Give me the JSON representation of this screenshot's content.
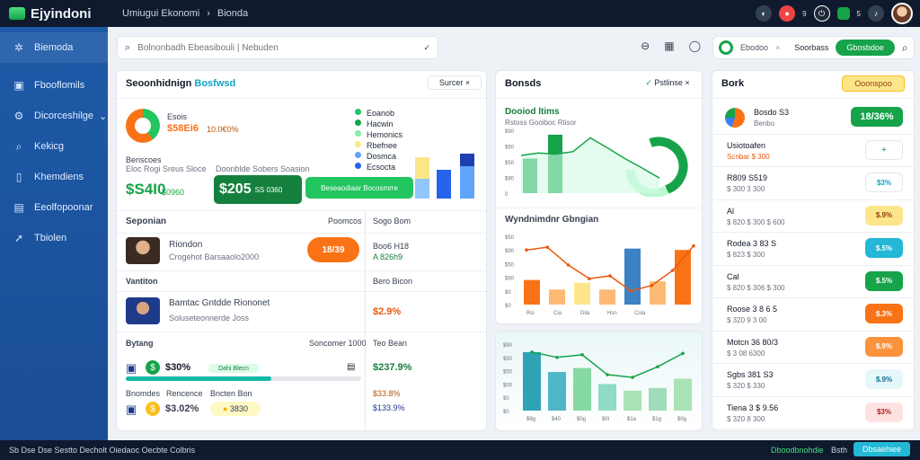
{
  "app": {
    "name": "Ejyindoni",
    "breadcrumb": [
      "Umiugui Ekonomi",
      "Bionda"
    ]
  },
  "topbar": {
    "notification_count": "9",
    "status_badge": "5"
  },
  "sidebar": {
    "items": [
      {
        "icon": "gear-icon",
        "label": "Biemoda"
      },
      {
        "icon": "grid-icon",
        "label": "Fbooflomils"
      },
      {
        "icon": "settings-icon",
        "label": "Dicorceshilge"
      },
      {
        "icon": "search-icon",
        "label": "Kekicg"
      },
      {
        "icon": "document-icon",
        "label": "Khemdiens"
      },
      {
        "icon": "image-icon",
        "label": "Eeolfopoonar"
      },
      {
        "icon": "send-icon",
        "label": "Tbiolen"
      }
    ]
  },
  "search": {
    "placeholder": "Bolnonbadh Ebeasibouli | Nebuden"
  },
  "tools": {
    "label": "Ebodoo",
    "mode": "Soorbass",
    "action": "Gbosbdoe"
  },
  "left_card": {
    "title": "Seoonhidnign",
    "title_accent": "Bosfwsd",
    "filter": "Surcer",
    "donut_label": "Esois",
    "donut_value": "$58Ei6",
    "donut_value2": "10.0€0%",
    "legend": [
      "Eoanob",
      "Hacwin",
      "Hemonics",
      "Rbefnee",
      "Dosmca",
      "Ecsocta"
    ],
    "sub_label": "Benscoes",
    "sub_caption": "Eloc Rogi Sreus Sloce",
    "metric_small": "$S4I0",
    "metric_small_sub": "$0960",
    "metric_big_caption": "Doonblde Sobers Soasion",
    "metric_big": "$205",
    "metric_big_sub": "SS 0360",
    "metric_big_btn": "Beseaodiaar Bocosmrre",
    "section": "Seponian",
    "section_mid": "Poomcos",
    "section_right": "Sogo Bom",
    "person1_name": "Riondon",
    "person1_sub": "Crogehot Barsaaolo2000",
    "person1_pill": "18/39",
    "person1_r1": "Boo6 H18",
    "person1_r2": "A 826h9",
    "row2": "Vantiton",
    "row2_right": "Bero Bicon",
    "person2_name": "Bamtac Gntdde Riononet",
    "person2_sub": "Soluseteonnerde Joss",
    "person2_val": "$2.9%",
    "row3": "Bytang",
    "row3_mid": "Soncomer 1000",
    "row3_right": "Teo Bean",
    "progress_label": "$30%",
    "progress_tag": "Dahi Blecn",
    "progress_val": "$237.9%",
    "progress_fill": 0.62,
    "row4a": "Bnomdes",
    "row4b": "Rencence",
    "row4c": "Bncten Bon",
    "row4_val": "$33.8%",
    "row5_val": "$3.02%",
    "row5_badge": "3830",
    "row5_val2": "$133.9%"
  },
  "middle_card": {
    "title": "Bonsds",
    "filter": "Pstlinse",
    "chart1_title": "Dooiod ltims",
    "chart1_sub": "Rstoss Gooiboc Rtisor",
    "chart1_y": [
      "$90",
      "$50",
      "$50",
      "$90",
      "0"
    ],
    "chart1_line": [
      60,
      64,
      62,
      66,
      88,
      72,
      55,
      40,
      24
    ],
    "chart1_bars": [
      {
        "value": 55,
        "color": "#16a34a"
      },
      {
        "value": 93,
        "color": "#16a34a"
      }
    ],
    "chart2_title": "Wyndnimdnr Gbngian",
    "chart2_y": [
      "$50",
      "$90",
      "$50",
      "$50",
      "$0",
      "$0"
    ],
    "chart2_x": [
      "Rsi",
      "Cia",
      "Dila",
      "Hsn",
      "Cola"
    ],
    "chart2_bars": [
      {
        "value": 36,
        "color": "#f97316"
      },
      {
        "value": 22,
        "color": "#fdba74"
      },
      {
        "value": 32,
        "color": "#fde68a"
      },
      {
        "value": 22,
        "color": "#fdba74"
      },
      {
        "value": 82,
        "color": "#3b82c4"
      },
      {
        "value": 34,
        "color": "#fdba74"
      },
      {
        "value": 80,
        "color": "#f97316"
      }
    ],
    "chart2_line": [
      80,
      84,
      58,
      38,
      42,
      20,
      28,
      50,
      86
    ],
    "chart3_y": [
      "$90",
      "$50",
      "$50",
      "$00",
      "$0",
      "$0"
    ],
    "chart3_x": [
      "$9g",
      "$40",
      "$0g",
      "$0l",
      "$1a",
      "$1g",
      "$0g"
    ],
    "chart3_bars": [
      {
        "value": 88,
        "color": "#2fa3b5"
      },
      {
        "value": 58,
        "color": "#4fb6c7"
      },
      {
        "value": 64,
        "color": "#86d9a0"
      },
      {
        "value": 40,
        "color": "#8fdbc5"
      },
      {
        "value": 30,
        "color": "#a9e3b5"
      },
      {
        "value": 34,
        "color": "#9fdcb9"
      },
      {
        "value": 48,
        "color": "#a9e3b5"
      }
    ],
    "chart3_line": [
      88,
      80,
      84,
      54,
      50,
      66,
      86
    ]
  },
  "right_card": {
    "title": "Bork",
    "action": "Ooonspoo",
    "items": [
      {
        "label": "Bosdo S3",
        "sub": "Benbo",
        "value": "18/36%",
        "color": "#16a34a",
        "fg": "#ffffff"
      },
      {
        "label": "Usiotoafen",
        "sub": "Scnbar $ 300",
        "value": "+",
        "color": "#ffffff",
        "fg": "#16a34a"
      },
      {
        "label": "R809 S519",
        "sub": "$ 300 3  300",
        "value": "$3%",
        "color": "#ffffff",
        "fg": "#0ea5c4"
      },
      {
        "label": "Al",
        "sub": "$ 820 $ 300 $ 600",
        "value": "$.9%",
        "color": "#fde68a",
        "fg": "#92400e"
      },
      {
        "label": "Rodea 3 83 S",
        "sub": "$ 823 $ 300",
        "value": "$.5%",
        "color": "#22b8d6",
        "fg": "#ffffff"
      },
      {
        "label": "Cal",
        "sub": "$ 820 $ 306 $ 300",
        "value": "$.5%",
        "color": "#16a34a",
        "fg": "#ffffff"
      },
      {
        "label": "Roose 3 8 6 5",
        "sub": "$ 320 9 3 00",
        "value": "$.3%",
        "color": "#f97316",
        "fg": "#ffffff"
      },
      {
        "label": "Motcn 36 80/3",
        "sub": "$ 3 08 6300",
        "value": "$.9%",
        "color": "#fb923c",
        "fg": "#ffffff"
      },
      {
        "label": "Sgbs 381 S3",
        "sub": "$ 320 $ 330",
        "value": "$.9%",
        "color": "#e6f7fa",
        "fg": "#0e7490"
      },
      {
        "label": "Tiena 3 $ 9.56",
        "sub": "$ 320 8 300",
        "value": "$3%",
        "color": "#fde2e2",
        "fg": "#b91c1c"
      }
    ]
  },
  "bottom": {
    "left": "Sb  Dse Dse Sestto  Decholt  Oiedaoc Oecbte  Colbris",
    "r1": "Dboodbnohdie",
    "r2": "Bsth",
    "btn": "Dbsaehiee"
  }
}
